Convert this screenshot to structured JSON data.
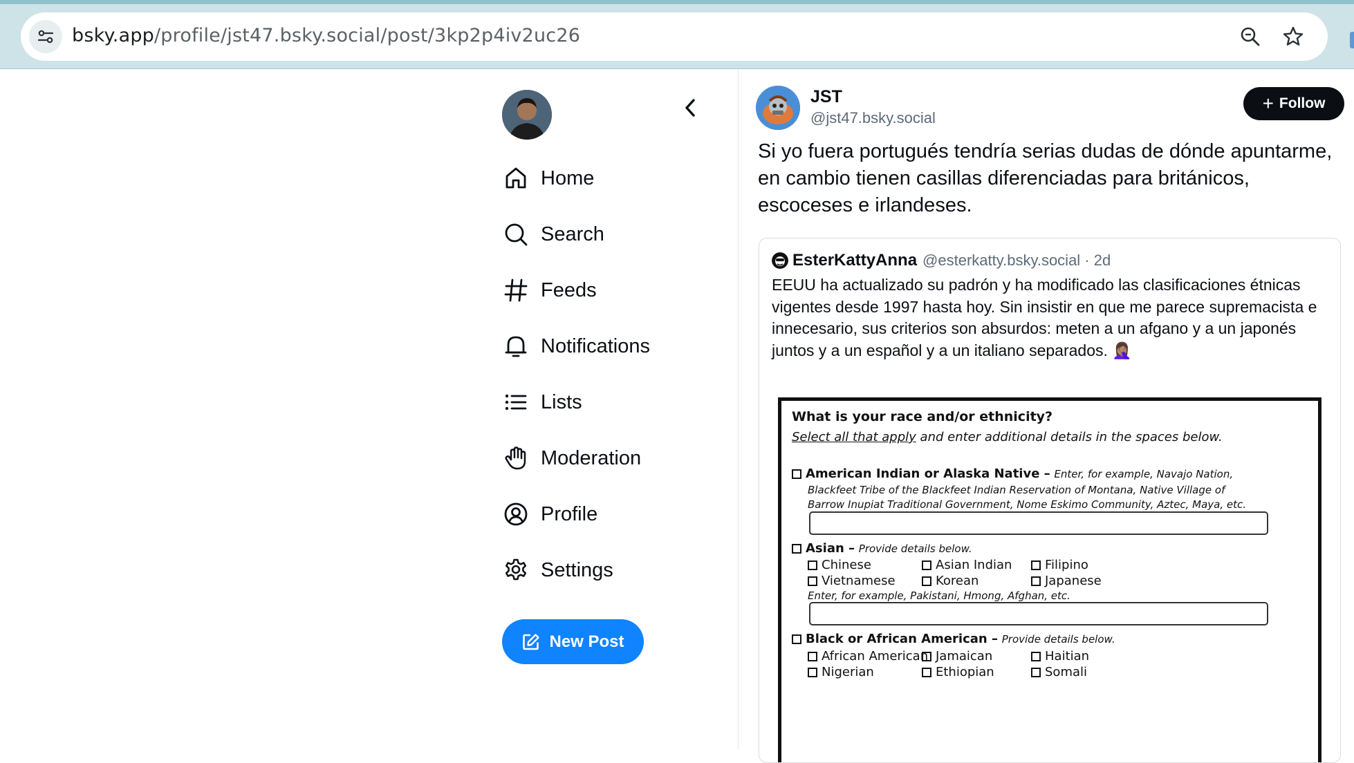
{
  "browser": {
    "url_domain": "bsky.app",
    "url_path": "/profile/jst47.bsky.social/post/3kp2p4iv2uc26"
  },
  "nav": {
    "items": [
      {
        "label": "Home",
        "icon": "home-icon"
      },
      {
        "label": "Search",
        "icon": "search-icon"
      },
      {
        "label": "Feeds",
        "icon": "hash-icon"
      },
      {
        "label": "Notifications",
        "icon": "bell-icon"
      },
      {
        "label": "Lists",
        "icon": "list-icon"
      },
      {
        "label": "Moderation",
        "icon": "hand-icon"
      },
      {
        "label": "Profile",
        "icon": "user-circle-icon"
      },
      {
        "label": "Settings",
        "icon": "gear-icon"
      }
    ],
    "new_post_label": "New Post"
  },
  "post": {
    "author_name": "JST",
    "author_handle": "@jst47.bsky.social",
    "follow_label": "Follow",
    "text": "Si yo fuera portugués tendría serias dudas de dónde apuntarme, en cambio tienen casillas diferenciadas para británicos, escoceses e irlandeses."
  },
  "quote": {
    "author_name": "EsterKattyAnna",
    "author_handle": "@esterkatty.bsky.social · 2d",
    "text": "EEUU ha actualizado su padrón y ha modificado las clasificaciones étnicas vigentes desde 1997 hasta hoy. Sin insistir en que me parece supremacista e innecesario, sus criterios son absurdos: meten a un afgano y a un japonés juntos y a un español y a un italiano separados. 🤦🏽‍♀️"
  },
  "form": {
    "question": "What is your race and/or ethnicity?",
    "sub_underlined": "Select all that apply",
    "sub_rest": " and enter additional details in the spaces below.",
    "aian_label": "American Indian or Alaska Native –",
    "aian_hint1": "Enter, for example, Navajo Nation,",
    "aian_hint2": "Blackfeet Tribe of the Blackfeet Indian Reservation of Montana, Native Village of",
    "aian_hint3": "Barrow Inupiat Traditional Government, Nome Eskimo Community, Aztec, Maya, etc.",
    "asian_label": "Asian –",
    "asian_hint": "Provide details below.",
    "asian_options": [
      "Chinese",
      "Asian Indian",
      "Filipino",
      "Vietnamese",
      "Korean",
      "Japanese"
    ],
    "asian_example": "Enter, for example, Pakistani, Hmong, Afghan, etc.",
    "black_label": "Black or African American –",
    "black_hint": "Provide details below.",
    "black_options": [
      "African American",
      "Jamaican",
      "Haitian",
      "Nigerian",
      "Ethiopian",
      "Somali"
    ]
  },
  "colors": {
    "accent": "#1083fe",
    "chrome": "#cde3e8",
    "text": "#0b0f14",
    "muted": "#5d6a78"
  }
}
